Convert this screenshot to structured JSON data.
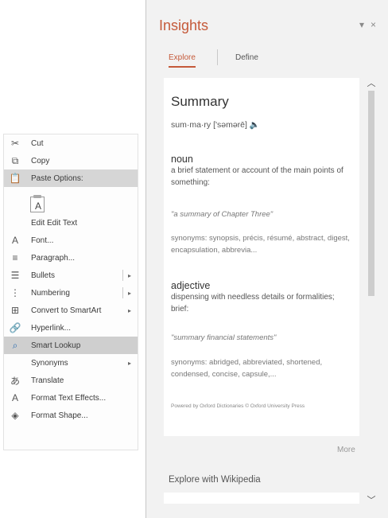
{
  "context_menu": {
    "items": [
      {
        "label": "Cut",
        "icon": "scissors-icon"
      },
      {
        "label": "Copy",
        "icon": "copy-icon"
      },
      {
        "label": "Paste Options:",
        "icon": "paste-icon"
      },
      {
        "label": "Edit Edit Text",
        "icon": ""
      },
      {
        "label": "Font...",
        "icon": "font-icon"
      },
      {
        "label": "Paragraph...",
        "icon": "paragraph-icon"
      },
      {
        "label": "Bullets",
        "icon": "bullets-icon"
      },
      {
        "label": "Numbering",
        "icon": "numbering-icon"
      },
      {
        "label": "Convert to SmartArt",
        "icon": "smartart-icon"
      },
      {
        "label": "Hyperlink...",
        "icon": "hyperlink-icon"
      },
      {
        "label": "Smart Lookup",
        "icon": "search-icon"
      },
      {
        "label": "Synonyms",
        "icon": ""
      },
      {
        "label": "Translate",
        "icon": "translate-icon"
      },
      {
        "label": "Format Text Effects...",
        "icon": "text-effects-icon"
      },
      {
        "label": "Format Shape...",
        "icon": "format-shape-icon"
      }
    ],
    "paste_glyph": "A"
  },
  "insights": {
    "title": "Insights",
    "pin_glyph": "▾",
    "close_glyph": "×",
    "tabs": [
      {
        "label": "Explore",
        "active": true
      },
      {
        "label": "Define",
        "active": false
      }
    ],
    "summary": {
      "word": "Summary",
      "pronunciation": "sum·ma·ry ['səmərē] 🔈",
      "senses": [
        {
          "pos": "noun",
          "definition": "a brief statement or account of the main points of something:",
          "example": "\"a summary of Chapter Three\"",
          "synonyms": "synonyms: synopsis, précis, résumé, abstract, digest, encapsulation, abbrevia..."
        },
        {
          "pos": "adjective",
          "definition": "dispensing with needless details or formalities; brief:",
          "example": "\"summary financial statements\"",
          "synonyms": "synonyms: abridged, abbreviated, shortened, condensed, concise, capsule,..."
        }
      ],
      "source": "Powered by Oxford Dictionaries © Oxford University Press"
    },
    "more_label": "More",
    "wikipedia_label": "Explore with Wikipedia"
  }
}
